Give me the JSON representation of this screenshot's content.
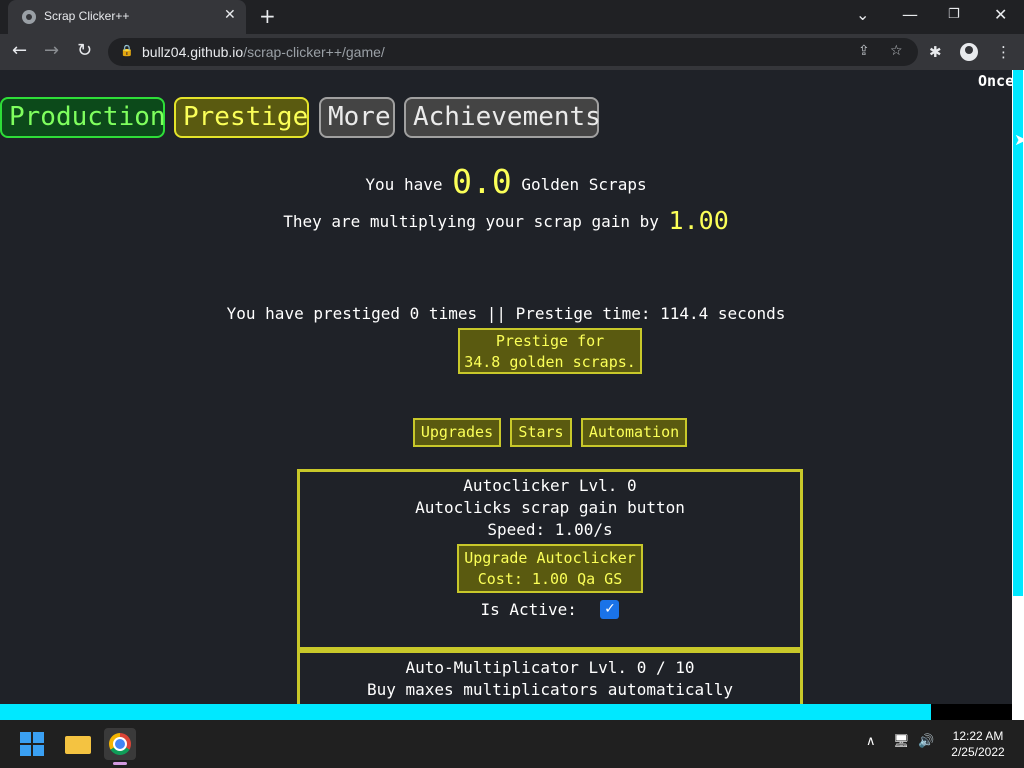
{
  "browser": {
    "tab_title": "Scrap Clicker++",
    "url_host": "bullz04.github.io",
    "url_path": "/scrap-clicker++/game/",
    "icons": [
      "back-icon",
      "forward-icon",
      "reload-icon",
      "share-icon",
      "star-icon",
      "extensions-icon",
      "profile-icon",
      "menu-icon"
    ]
  },
  "page": {
    "corner_text": "Once",
    "main_tabs": [
      "Production",
      "Prestige",
      "More",
      "Achievements"
    ],
    "golden": {
      "prefix": "You have",
      "amount": "0.0",
      "suffix": "Golden Scraps",
      "mult_text": "They are multiplying your scrap gain by",
      "mult_value": "1.00"
    },
    "prestige_info": "You have prestiged 0 times || Prestige time: 114.4 seconds",
    "prestige_button": {
      "line1": "Prestige for",
      "line2": "34.8 golden scraps."
    },
    "sub_tabs": [
      "Upgrades",
      "Stars",
      "Automation"
    ],
    "autoclicker": {
      "title": "Autoclicker Lvl. 0",
      "desc": "Autoclicks scrap gain button",
      "speed": "Speed: 1.00/s",
      "button_line1": "Upgrade Autoclicker",
      "button_line2": "Cost: 1.00 Qa GS",
      "active_label": "Is Active:",
      "active": true
    },
    "automultiplicator": {
      "title": "Auto-Multiplicator Lvl. 0 / 10",
      "desc": "Buy maxes multiplicators automatically"
    },
    "progress_fraction": 0.92
  },
  "taskbar": {
    "time": "12:22 AM",
    "date": "2/25/2022",
    "colors": {
      "accent_cyan": "#00e8ff",
      "win_blue": "#3aa0f3"
    }
  }
}
